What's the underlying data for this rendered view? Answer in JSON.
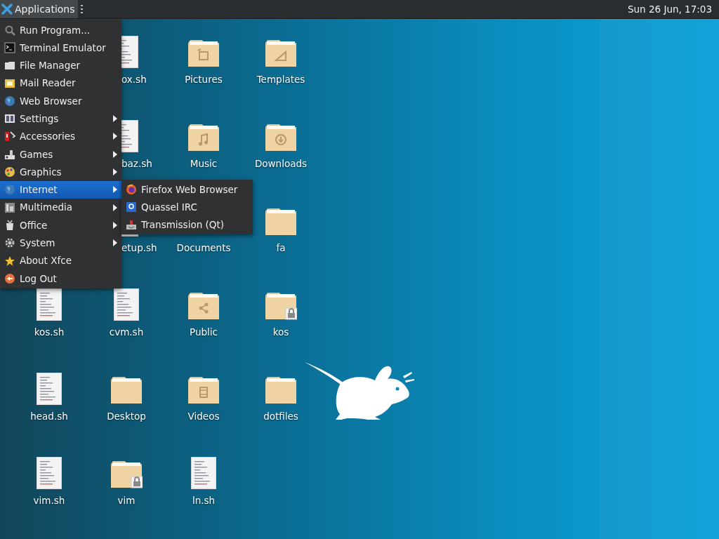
{
  "panel": {
    "applications_button": {
      "label": "Applications",
      "open": true
    },
    "clock": "Sun 26 Jun, 17:03"
  },
  "desktop_rows": [
    {
      "offset": true,
      "icons": [
        {
          "kind": "script",
          "label": "ox.sh",
          "clipped": true
        },
        {
          "kind": "folder-pictures",
          "label": "Pictures",
          "clipped": false
        },
        {
          "kind": "folder-templates",
          "label": "Templates",
          "clipped": false
        }
      ]
    },
    {
      "offset": true,
      "icons": [
        {
          "kind": "script",
          "label": "baz.sh",
          "clipped": true
        },
        {
          "kind": "folder-music",
          "label": "Music",
          "clipped": false
        },
        {
          "kind": "folder-downloads",
          "label": "Downloads",
          "clipped": false
        }
      ]
    },
    {
      "offset": true,
      "icons": [
        {
          "kind": "script",
          "label": "etup.sh",
          "clipped": true
        },
        {
          "kind": "covered",
          "label": "Documents",
          "clipped": false
        },
        {
          "kind": "folder",
          "label": "fa",
          "clipped": false
        }
      ]
    },
    {
      "offset": false,
      "icons": [
        {
          "kind": "script",
          "label": "kos.sh",
          "clipped": false
        },
        {
          "kind": "script",
          "label": "cvm.sh",
          "clipped": false
        },
        {
          "kind": "folder-public",
          "label": "Public",
          "clipped": false
        },
        {
          "kind": "folder-locked",
          "label": "kos",
          "clipped": false
        }
      ]
    },
    {
      "offset": false,
      "icons": [
        {
          "kind": "script",
          "label": "head.sh",
          "clipped": false
        },
        {
          "kind": "folder",
          "label": "Desktop",
          "clipped": false
        },
        {
          "kind": "folder-videos",
          "label": "Videos",
          "clipped": false
        },
        {
          "kind": "folder",
          "label": "dotfiles",
          "clipped": false
        }
      ]
    },
    {
      "offset": false,
      "icons": [
        {
          "kind": "script",
          "label": "vim.sh",
          "clipped": false
        },
        {
          "kind": "folder-locked",
          "label": "vim",
          "clipped": false
        },
        {
          "kind": "script",
          "label": "ln.sh",
          "clipped": false
        }
      ]
    }
  ],
  "menu": {
    "items": [
      {
        "label": "Run Program...",
        "submenu": false,
        "selected": false
      },
      {
        "label": "Terminal Emulator",
        "submenu": false,
        "selected": false
      },
      {
        "label": "File Manager",
        "submenu": false,
        "selected": false
      },
      {
        "label": "Mail Reader",
        "submenu": false,
        "selected": false
      },
      {
        "label": "Web Browser",
        "submenu": false,
        "selected": false
      },
      {
        "label": "Settings",
        "submenu": true,
        "selected": false
      },
      {
        "label": "Accessories",
        "submenu": true,
        "selected": false
      },
      {
        "label": "Games",
        "submenu": true,
        "selected": false
      },
      {
        "label": "Graphics",
        "submenu": true,
        "selected": false
      },
      {
        "label": "Internet",
        "submenu": true,
        "selected": true
      },
      {
        "label": "Multimedia",
        "submenu": true,
        "selected": false
      },
      {
        "label": "Office",
        "submenu": true,
        "selected": false
      },
      {
        "label": "System",
        "submenu": true,
        "selected": false
      },
      {
        "label": "About Xfce",
        "submenu": false,
        "selected": false
      },
      {
        "label": "Log Out",
        "submenu": false,
        "selected": false
      }
    ],
    "submenu": {
      "items": [
        {
          "label": "Firefox Web Browser",
          "selected": false
        },
        {
          "label": "Quassel IRC",
          "selected": false
        },
        {
          "label": "Transmission (Qt)",
          "selected": false
        }
      ]
    }
  }
}
